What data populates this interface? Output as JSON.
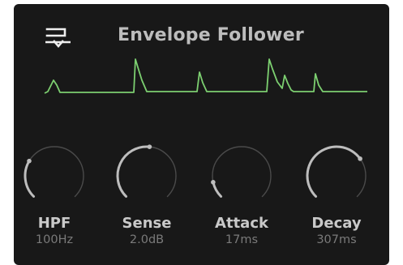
{
  "window": {
    "title": "Envelope Follower"
  },
  "icons": {
    "header": "envelope-follower-icon"
  },
  "colors": {
    "panel_bg": "#181818",
    "title": "#bdbdbd",
    "waveform": "#7ccf70",
    "knob_track": "#4a4a4a",
    "knob_active": "#bdbdbd",
    "knob_label": "#c9c9c9",
    "knob_value": "#7a7a7a"
  },
  "knobs": [
    {
      "label": "HPF",
      "value": "100Hz",
      "level": 0.28
    },
    {
      "label": "Sense",
      "value": "2.0dB",
      "level": 0.52
    },
    {
      "label": "Attack",
      "value": "17ms",
      "level": 0.12
    },
    {
      "label": "Decay",
      "value": "307ms",
      "level": 0.7
    }
  ]
}
